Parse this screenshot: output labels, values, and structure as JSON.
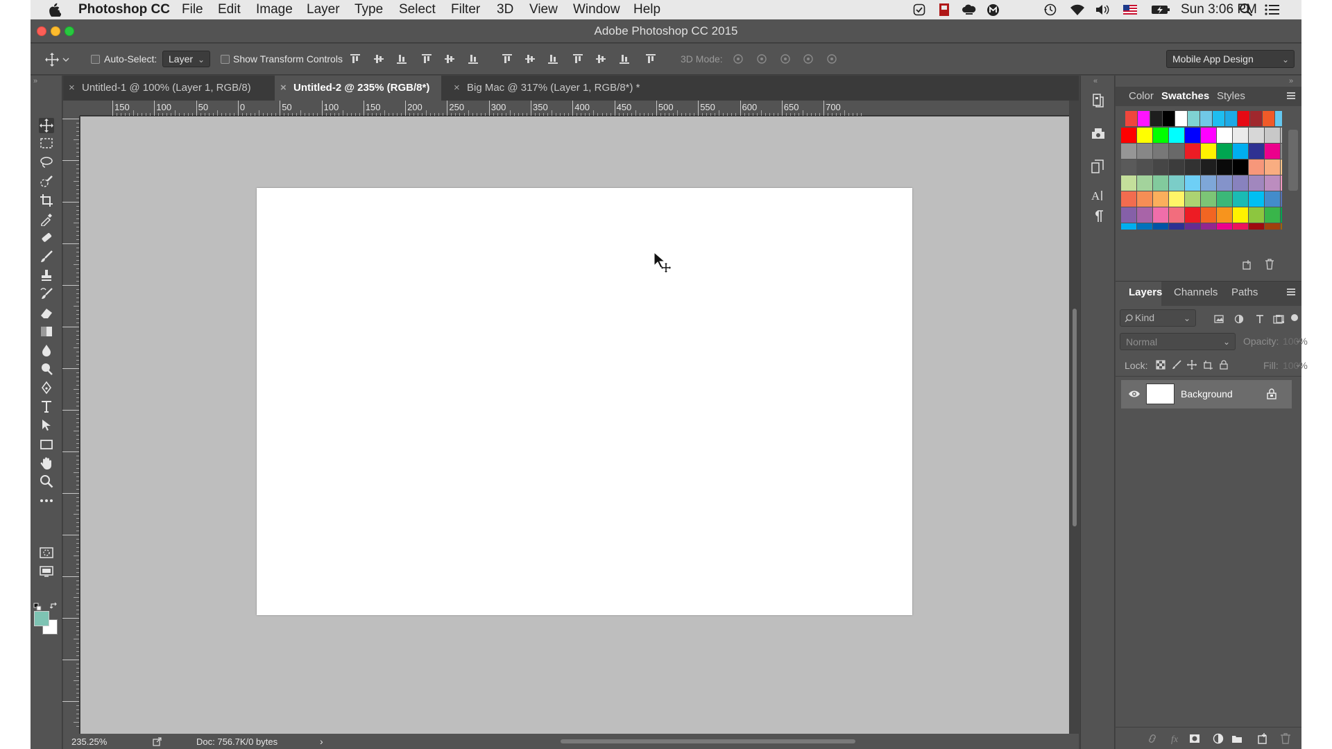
{
  "menubar": {
    "app_name": "Photoshop CC",
    "items": [
      "File",
      "Edit",
      "Image",
      "Layer",
      "Type",
      "Select",
      "Filter",
      "3D",
      "View",
      "Window",
      "Help"
    ],
    "clock": "Sun 3:06 PM",
    "status_icons": [
      "timer-icon",
      "flashcard-icon",
      "cloud-icon",
      "m-icon",
      "time-machine-icon",
      "wifi-icon",
      "volume-icon",
      "flag-icon",
      "battery-icon",
      "search-icon",
      "list-icon"
    ]
  },
  "window": {
    "title": "Adobe Photoshop CC 2015"
  },
  "options": {
    "auto_select_label": "Auto-Select:",
    "auto_select_value": "Layer",
    "transform_label": "Show Transform Controls",
    "mode_3d_label": "3D Mode:",
    "workspace": "Mobile App Design"
  },
  "tabs": [
    {
      "label": "Untitled-1 @ 100% (Layer 1, RGB/8)",
      "active": false
    },
    {
      "label": "Untitled-2 @ 235% (RGB/8*)",
      "active": true
    },
    {
      "label": "Big Mac @ 317% (Layer 1, RGB/8*) *",
      "active": false
    }
  ],
  "ruler": {
    "h_labels": [
      "150",
      "100",
      "50",
      "0",
      "50",
      "100",
      "150",
      "200",
      "250",
      "300",
      "350",
      "400",
      "450",
      "500",
      "550",
      "600",
      "650",
      "700"
    ]
  },
  "status": {
    "zoom": "235.25%",
    "doc": "Doc: 756.7K/0 bytes"
  },
  "color_panel": {
    "tabs": [
      "Color",
      "Swatches",
      "Styles"
    ],
    "active_tab": "Swatches"
  },
  "layers_panel": {
    "tabs": [
      "Layers",
      "Channels",
      "Paths"
    ],
    "active_tab": "Layers",
    "kind_label": "Kind",
    "blend_mode": "Normal",
    "opacity_label": "Opacity:",
    "opacity_value": "100%",
    "lock_label": "Lock:",
    "fill_label": "Fill:",
    "fill_value": "100%",
    "layers": [
      {
        "name": "Background",
        "visible": true,
        "locked": true
      }
    ]
  },
  "colors": {
    "foreground": "#7ec3b3",
    "background": "#ffffff"
  },
  "swatches": [
    [
      "#f0463c",
      "#ff14ff",
      "#1e1e1e",
      "#000000",
      "#ffffff",
      "#7fd2d2",
      "#70c8e6",
      "#1ebef0",
      "#1eaae6",
      "#e60a14",
      "#a0282d",
      "#f05a28",
      "#64c8f0"
    ],
    [
      "#ff0000",
      "#ffff00",
      "#00ff00",
      "#00ffff",
      "#0000ff",
      "#ff00ff",
      "#ffffff",
      "#ebebeb",
      "#d7d7d7",
      "#c8c8c8",
      "#b9b9b9",
      "#a5a5a5"
    ],
    [
      "#969696",
      "#878787",
      "#787878",
      "#696969",
      "#ed1c24",
      "#fff200",
      "#00a651",
      "#00aeef",
      "#2e3192",
      "#ec008c",
      "#8c8c8c",
      "#787878"
    ],
    [
      "#5a5a5a",
      "#505050",
      "#464646",
      "#3c3c3c",
      "#323232",
      "#1e1e1e",
      "#0a0a0a",
      "#000000",
      "#f7977a",
      "#f9ad81",
      "#fdc68a",
      "#fff79a"
    ],
    [
      "#c4df9b",
      "#a3d39c",
      "#82ca9d",
      "#7bcdc8",
      "#6ecff6",
      "#7ea7d8",
      "#8493ca",
      "#8882be",
      "#a187be",
      "#bc8dbf",
      "#f49ac2",
      "#f6989d"
    ],
    [
      "#f26c4f",
      "#f68e55",
      "#fbaf5c",
      "#fff467",
      "#acd372",
      "#7cc576",
      "#3bb878",
      "#1abbb4",
      "#00bff3",
      "#438ccb",
      "#5574b9",
      "#605ca8"
    ],
    [
      "#8560a8",
      "#a864a8",
      "#f06eaa",
      "#f26d7d",
      "#ed1c24",
      "#f26522",
      "#f7941d",
      "#fff200",
      "#8dc63f",
      "#39b54a",
      "#00a651",
      "#00a99d"
    ],
    [
      "#00aeef",
      "#0072bc",
      "#0054a6",
      "#2e3192",
      "#662d91",
      "#92278f",
      "#ec008c",
      "#ed145b",
      "#9e0b0f",
      "#a0410d",
      "#a36209",
      "#aba000"
    ]
  ]
}
